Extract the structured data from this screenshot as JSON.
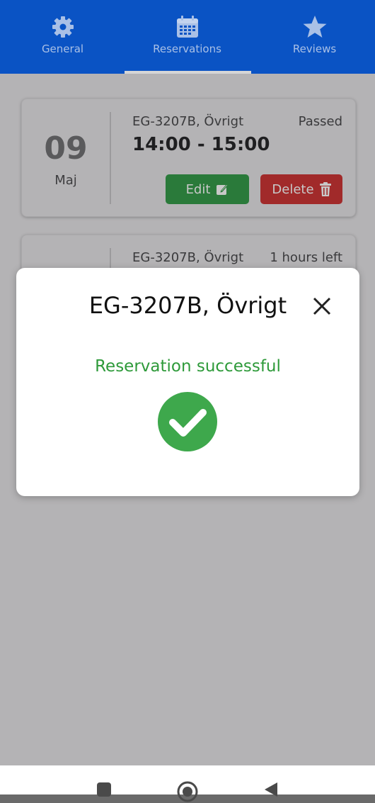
{
  "tabs": [
    {
      "label": "General",
      "icon": "gear-icon"
    },
    {
      "label": "Reservations",
      "icon": "calendar-icon"
    },
    {
      "label": "Reviews",
      "icon": "star-icon"
    }
  ],
  "reservations": [
    {
      "day": "09",
      "month": "Maj",
      "room": "EG-3207B, Övrigt",
      "status": "Passed",
      "time": "14:00 - 15:00",
      "edit_label": "Edit",
      "delete_label": "Delete"
    },
    {
      "room": "EG-3207B, Övrigt",
      "status": "1 hours left"
    }
  ],
  "modal": {
    "title": "EG-3207B, Övrigt",
    "message": "Reservation successful"
  },
  "colors": {
    "nav_bg": "#0a53c4",
    "success_green": "#2e9a3a",
    "check_green": "#3ea84c",
    "edit_green": "#2a7a3a",
    "delete_red": "#a12a2a"
  }
}
